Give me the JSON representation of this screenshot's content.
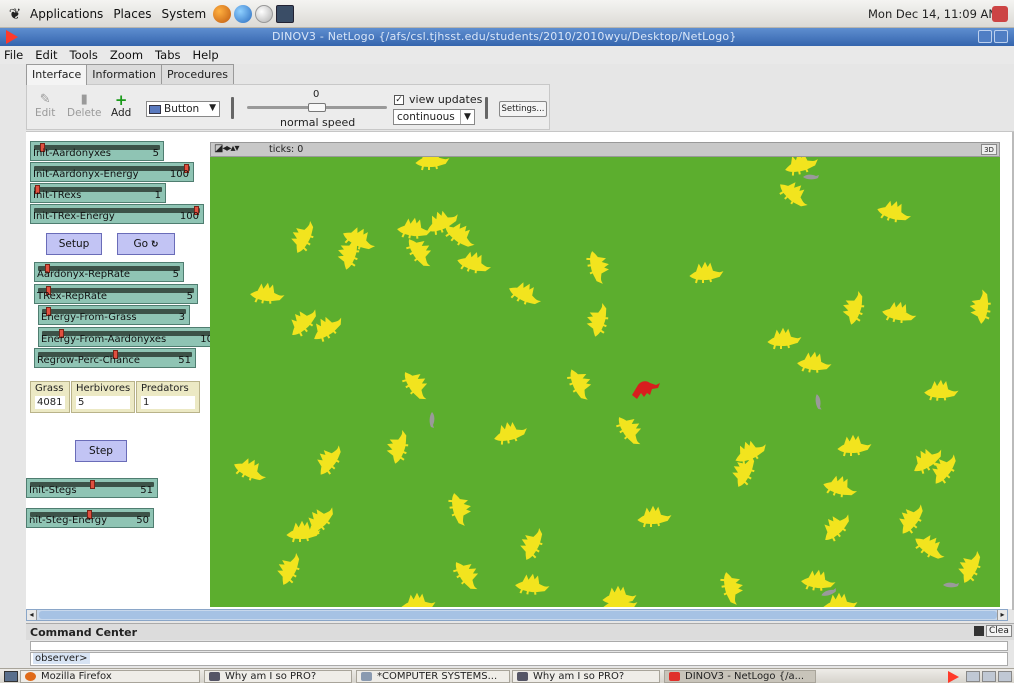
{
  "panel": {
    "menus": [
      "Applications",
      "Places",
      "System"
    ],
    "clock": "Mon Dec 14, 11:09 AM"
  },
  "window": {
    "title": "DINOV3 - NetLogo {/afs/csl.tjhsst.edu/students/2010/2010wyu/Desktop/NetLogo}"
  },
  "menubar": [
    "File",
    "Edit",
    "Tools",
    "Zoom",
    "Tabs",
    "Help"
  ],
  "tabs": [
    "Interface",
    "Information",
    "Procedures"
  ],
  "toolbar": {
    "edit": "Edit",
    "delete": "Delete",
    "add": "Add",
    "widget_type": "Button",
    "speed_value": "0",
    "speed_label": "normal speed",
    "view_updates_label": "view updates",
    "view_updates_checked": true,
    "update_mode": "continuous",
    "settings": "Settings..."
  },
  "sliders": [
    {
      "label": "Init-Aardonyxes",
      "value": "5",
      "level": 0.05
    },
    {
      "label": "Init-Aardonyx-Energy",
      "value": "100",
      "level": 1.0
    },
    {
      "label": "Init-TRexs",
      "value": "1",
      "level": 0.01
    },
    {
      "label": "Init-TRex-Energy",
      "value": "100",
      "level": 1.0
    },
    {
      "label": "Aardonyx-RepRate",
      "value": "5",
      "level": 0.05
    },
    {
      "label": "TRex-RepRate",
      "value": "5",
      "level": 0.05
    },
    {
      "label": "Energy-From-Grass",
      "value": "3",
      "level": 0.03
    },
    {
      "label": "Energy-From-Aardonyxes",
      "value": "10",
      "level": 0.1
    },
    {
      "label": "Regrow-Perc-Chance",
      "value": "51",
      "level": 0.51
    },
    {
      "label": "Init-Stegs",
      "value": "51",
      "level": 0.51
    },
    {
      "label": "nit-Steg-Energy",
      "value": "50",
      "level": 0.5
    }
  ],
  "buttons": {
    "setup": "Setup",
    "go": "Go",
    "step": "Step"
  },
  "monitors": [
    {
      "label": "Grass",
      "value": "4081"
    },
    {
      "label": "Herbivores",
      "value": "5"
    },
    {
      "label": "Predators",
      "value": "1"
    }
  ],
  "view": {
    "ticks_label": "ticks: 0",
    "btn_3d": "3D",
    "colors": {
      "grass": "#5cae2e",
      "steg": "#f2e41e",
      "trex": "#d81e1e",
      "aardonyx": "#9a9a9a"
    }
  },
  "command_center": {
    "title": "Command Center",
    "clear": "Clea",
    "prompt": "observer>"
  },
  "taskbar": [
    "Mozilla Firefox",
    "Why am I so PRO?",
    "*COMPUTER SYSTEMS...",
    "Why am I so PRO?",
    "DINOV3 - NetLogo {/a..."
  ]
}
